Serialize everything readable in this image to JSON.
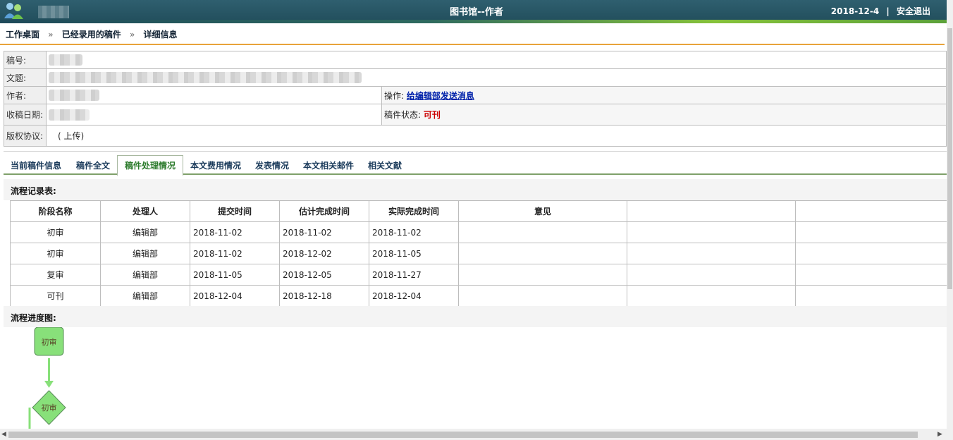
{
  "header": {
    "title": "图书馆--作者",
    "date": "2018-12-4",
    "separator": "|",
    "logout": "安全退出"
  },
  "breadcrumb": {
    "items": [
      "工作桌面",
      "已经录用的稿件",
      "详细信息"
    ],
    "separator": "»"
  },
  "info": {
    "manuscript_no_label": "稿号:",
    "title_label": "文题:",
    "author_label": "作者:",
    "received_label": "收稿日期:",
    "copyright_label": "版权协议:",
    "copyright_value": "( 上传)",
    "operation_label": "操作:",
    "operation_link": "给编辑部发送消息",
    "status_label": "稿件状态:",
    "status_value": "可刊",
    "status_color": "#cc0000"
  },
  "tabs": [
    {
      "label": "当前稿件信息"
    },
    {
      "label": "稿件全文"
    },
    {
      "label": "稿件处理情况"
    },
    {
      "label": "本文费用情况"
    },
    {
      "label": "发表情况"
    },
    {
      "label": "本文相关邮件"
    },
    {
      "label": "相关文献"
    }
  ],
  "active_tab": "稿件处理情况",
  "flow_section_title": "流程记录表:",
  "flow_table": {
    "headers": [
      "阶段名称",
      "处理人",
      "提交时间",
      "估计完成时间",
      "实际完成时间",
      "意见",
      "",
      ""
    ],
    "rows": [
      [
        "初审",
        "编辑部",
        "2018-11-02",
        "2018-11-02",
        "2018-11-02",
        "",
        "",
        ""
      ],
      [
        "初审",
        "编辑部",
        "2018-11-02",
        "2018-12-02",
        "2018-11-05",
        "",
        "",
        ""
      ],
      [
        "复审",
        "编辑部",
        "2018-11-05",
        "2018-12-05",
        "2018-11-27",
        "",
        "",
        ""
      ],
      [
        "可刊",
        "编辑部",
        "2018-12-04",
        "2018-12-18",
        "2018-12-04",
        "",
        "",
        ""
      ]
    ]
  },
  "progress_section_title": "流程进度图:",
  "diagram": {
    "node1": "初审",
    "node2": "初审",
    "node_fill": "#88e07a",
    "arrow_color": "#88e07a"
  }
}
